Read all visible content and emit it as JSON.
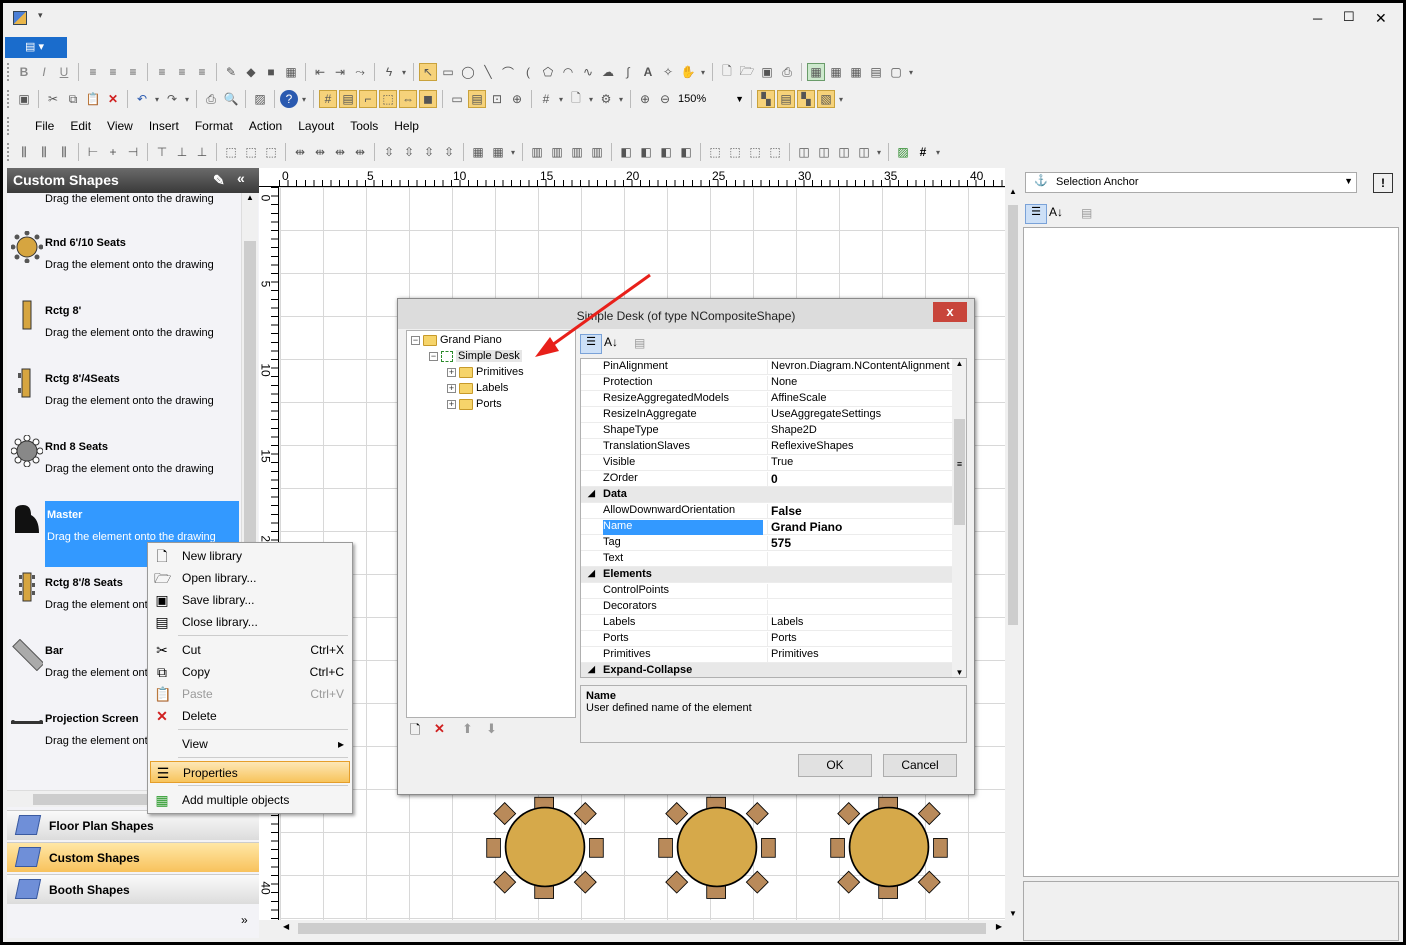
{
  "window": {
    "min": "─",
    "max": "☐",
    "close": "✕"
  },
  "menu": [
    "File",
    "Edit",
    "View",
    "Insert",
    "Format",
    "Action",
    "Layout",
    "Tools",
    "Help"
  ],
  "toolbar": {
    "zoom": "150%"
  },
  "library": {
    "title": "Custom Shapes",
    "items": [
      {
        "name": "",
        "desc": "Drag the element onto the drawing"
      },
      {
        "name": "Rnd 6'/10 Seats",
        "desc": "Drag the element onto the drawing"
      },
      {
        "name": "Rctg 8'",
        "desc": "Drag the element onto the drawing"
      },
      {
        "name": "Rctg 8'/4Seats",
        "desc": "Drag the element onto the drawing"
      },
      {
        "name": "Rnd 8 Seats",
        "desc": "Drag the element onto the drawing"
      },
      {
        "name": "Master",
        "desc": "Drag the element onto the drawing"
      },
      {
        "name": "Rctg 8'/8 Seats",
        "desc": "Drag the element onto the drawing"
      },
      {
        "name": "Bar",
        "desc": "Drag the element onto the drawing"
      },
      {
        "name": "Projection Screen",
        "desc": "Drag the element onto the drawing"
      }
    ],
    "categories": [
      "Floor Plan Shapes",
      "Custom Shapes",
      "Booth Shapes"
    ]
  },
  "context_menu": {
    "items": [
      {
        "label": "New library",
        "key": ""
      },
      {
        "label": "Open library...",
        "key": ""
      },
      {
        "label": "Save library...",
        "key": ""
      },
      {
        "label": "Close library...",
        "key": ""
      },
      {
        "label": "Cut",
        "key": "Ctrl+X"
      },
      {
        "label": "Copy",
        "key": "Ctrl+C"
      },
      {
        "label": "Paste",
        "key": "Ctrl+V"
      },
      {
        "label": "Delete",
        "key": ""
      },
      {
        "label": "View",
        "key": "▸"
      },
      {
        "label": "Properties",
        "key": ""
      },
      {
        "label": "Add multiple objects",
        "key": ""
      }
    ]
  },
  "ruler": {
    "h": [
      "0",
      "5",
      "10",
      "15",
      "20",
      "25",
      "30",
      "35",
      "40"
    ],
    "v": [
      "0",
      "5",
      "10",
      "15",
      "20",
      "40"
    ]
  },
  "dialog": {
    "title": "Simple Desk (of type NCompositeShape)",
    "close": "x",
    "tree": [
      "Grand Piano",
      "Simple Desk",
      "Primitives",
      "Labels",
      "Ports"
    ],
    "props": [
      {
        "name": "PinAlignment",
        "value": "Nevron.Diagram.NContentAlignment"
      },
      {
        "name": "Protection",
        "value": "None"
      },
      {
        "name": "ResizeAggregatedModels",
        "value": "AffineScale"
      },
      {
        "name": "ResizeInAggregate",
        "value": "UseAggregateSettings"
      },
      {
        "name": "ShapeType",
        "value": "Shape2D"
      },
      {
        "name": "TranslationSlaves",
        "value": "ReflexiveShapes"
      },
      {
        "name": "Visible",
        "value": "True"
      },
      {
        "name": "ZOrder",
        "value": "0"
      },
      {
        "name": "Data",
        "value": ""
      },
      {
        "name": "AllowDownwardOrientation",
        "value": "False"
      },
      {
        "name": "Name",
        "value": "Grand Piano"
      },
      {
        "name": "Tag",
        "value": "575"
      },
      {
        "name": "Text",
        "value": ""
      },
      {
        "name": "Elements",
        "value": ""
      },
      {
        "name": "ControlPoints",
        "value": ""
      },
      {
        "name": "Decorators",
        "value": ""
      },
      {
        "name": "Labels",
        "value": "Labels"
      },
      {
        "name": "Ports",
        "value": "Ports"
      },
      {
        "name": "Primitives",
        "value": "Primitives"
      },
      {
        "name": "Expand-Collapse",
        "value": ""
      }
    ],
    "desc_title": "Name",
    "desc_text": "User defined name of the element",
    "ok": "OK",
    "cancel": "Cancel"
  },
  "right_panel": {
    "selector": "Selection Anchor"
  }
}
